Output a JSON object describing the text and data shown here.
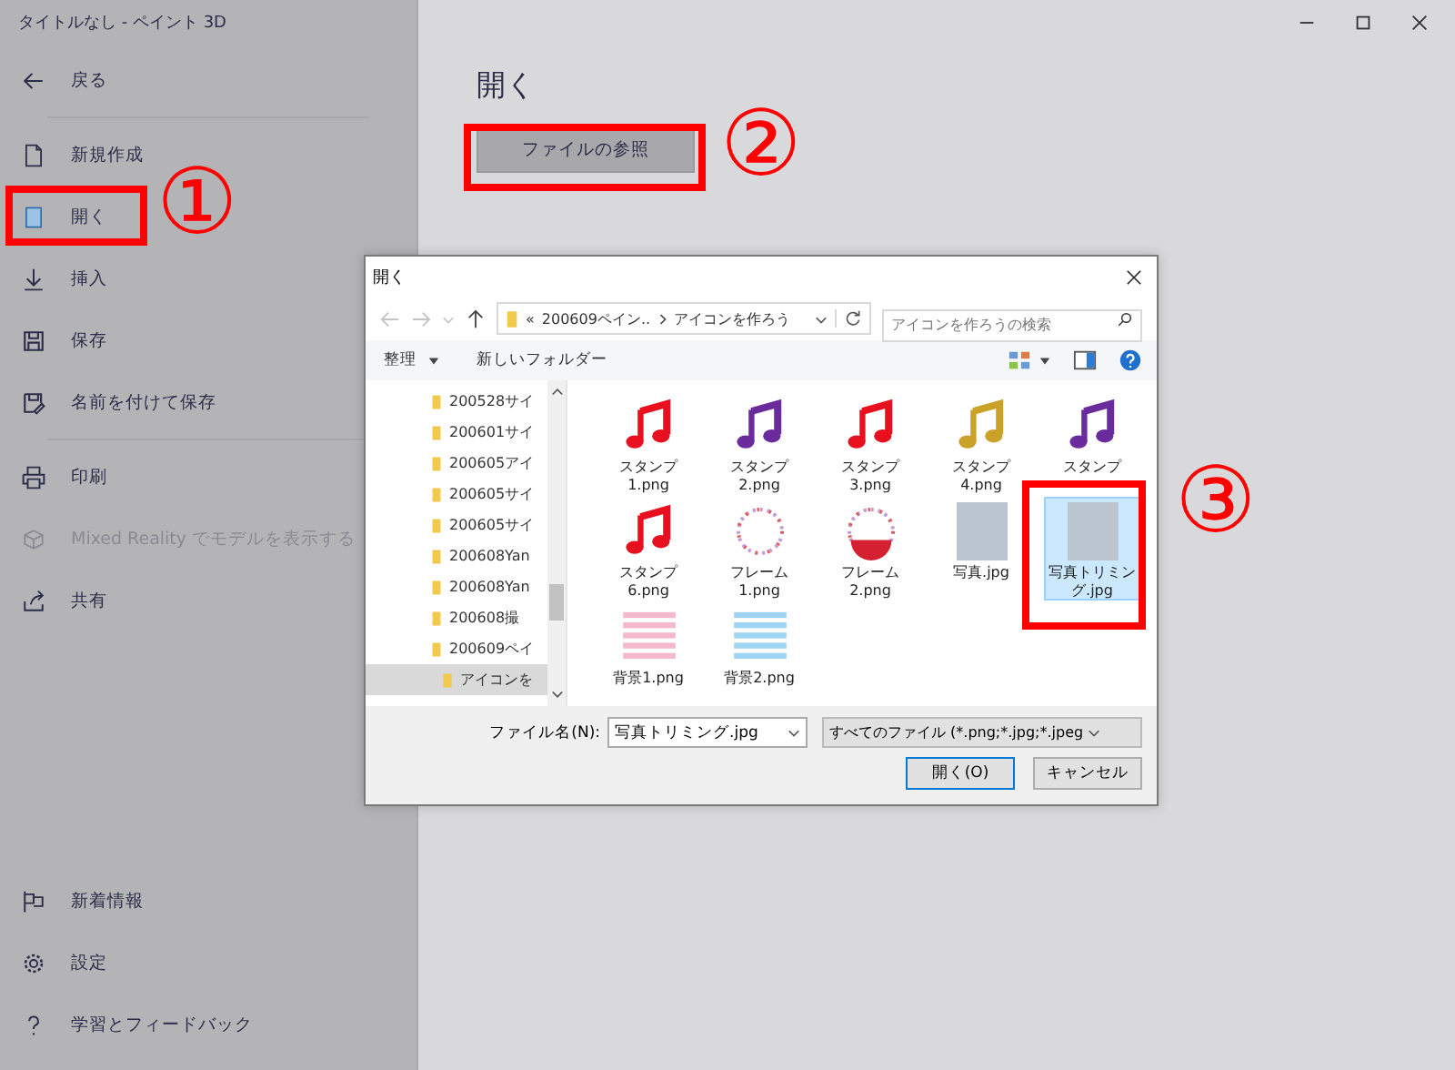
{
  "window": {
    "title": "タイトルなし - ペイント 3D"
  },
  "sidebar": {
    "back": "戻る",
    "items": [
      {
        "label": "新規作成",
        "disabled": false
      },
      {
        "label": "開く",
        "disabled": false
      },
      {
        "label": "挿入",
        "disabled": false
      },
      {
        "label": "保存",
        "disabled": false
      },
      {
        "label": "名前を付けて保存",
        "disabled": false
      },
      {
        "label": "印刷",
        "disabled": false
      },
      {
        "label": "Mixed Reality でモデルを表示する",
        "disabled": true
      },
      {
        "label": "共有",
        "disabled": false
      }
    ],
    "bottom_items": [
      {
        "label": "新着情報"
      },
      {
        "label": "設定"
      },
      {
        "label": "学習とフィードバック"
      }
    ]
  },
  "main": {
    "heading": "開く",
    "browse_button": "ファイルの参照"
  },
  "dialog": {
    "title": "開く",
    "address": {
      "overflow": "«",
      "segments": [
        "200609ペイン..",
        "アイコンを作ろう"
      ]
    },
    "search": {
      "placeholder": "アイコンを作ろうの検索"
    },
    "toolbar": {
      "organize": "整理",
      "new_folder": "新しいフォルダー"
    },
    "tree": [
      {
        "label": "200528サイ",
        "selected": false
      },
      {
        "label": "200601サイ",
        "selected": false
      },
      {
        "label": "200605アイ",
        "selected": false
      },
      {
        "label": "200605サイ",
        "selected": false
      },
      {
        "label": "200605サイ",
        "selected": false
      },
      {
        "label": "200608Yan",
        "selected": false
      },
      {
        "label": "200608Yan",
        "selected": false
      },
      {
        "label": "200608撮",
        "selected": false
      },
      {
        "label": "200609ペイ",
        "selected": false,
        "children": [
          {
            "label": "アイコンを",
            "selected": true
          }
        ]
      }
    ],
    "files": [
      {
        "name": "スタンプ1.png",
        "kind": "note",
        "color": "#e8101e",
        "selected": false
      },
      {
        "name": "スタンプ2.png",
        "kind": "note",
        "color": "#6a2c9c",
        "selected": false
      },
      {
        "name": "スタンプ3.png",
        "kind": "note",
        "color": "#e8101e",
        "selected": false
      },
      {
        "name": "スタンプ4.png",
        "kind": "note",
        "color": "#c9a227",
        "selected": false
      },
      {
        "name": "スタンプ",
        "kind": "note",
        "color": "#6a2c9c",
        "selected": false
      },
      {
        "name": "スタンプ6.png",
        "kind": "note",
        "color": "#e8101e",
        "selected": false
      },
      {
        "name": "フレーム1.png",
        "kind": "frame",
        "selected": false
      },
      {
        "name": "フレーム2.png",
        "kind": "frame",
        "selected": false
      },
      {
        "name": "写真.jpg",
        "kind": "photo",
        "selected": false
      },
      {
        "name": "写真トリミング.jpg",
        "kind": "photo",
        "selected": true
      },
      {
        "name": "背景1.png",
        "kind": "stripes",
        "color": "#f6b8cc",
        "selected": false
      },
      {
        "name": "背景2.png",
        "kind": "stripes",
        "color": "#9fd4f2",
        "selected": false
      }
    ],
    "file_name_label": "ファイル名(N):",
    "file_name": "写真トリミング.jpg",
    "filter": "すべてのファイル (*.png;*.jpg;*.jpeg",
    "open_button": "開く(O)",
    "cancel_button": "キャンセル"
  },
  "annotations": [
    {
      "label": "①"
    },
    {
      "label": "②"
    },
    {
      "label": "③"
    }
  ]
}
